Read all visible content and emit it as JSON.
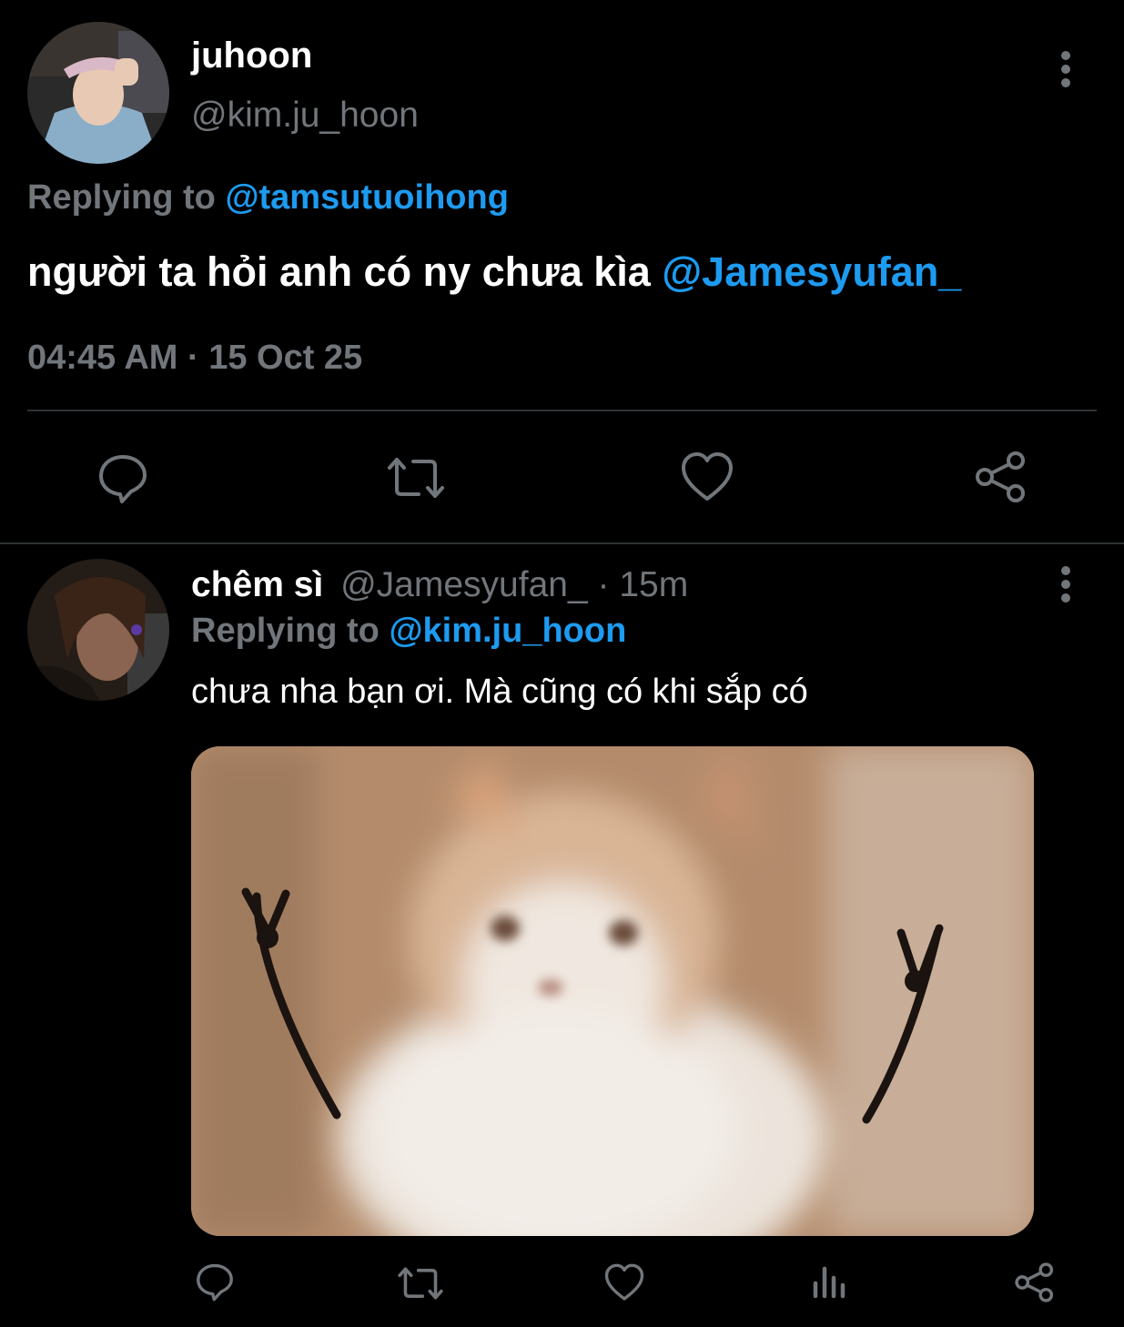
{
  "tweet": {
    "author_name": "juhoon",
    "author_handle": "@kim.ju_hoon",
    "replying_prefix": "Replying to",
    "replying_to": "@tamsutuoihong",
    "text": "người ta hỏi anh có ny chưa kìa",
    "mention": "@Jamesyufan_",
    "timestamp": "04:45 AM · 15 Oct 25",
    "actions": [
      "reply-icon",
      "retweet-icon",
      "like-icon",
      "share-icon"
    ],
    "more_icon": "more-vertical-icon"
  },
  "reply": {
    "author_name": "chêm sì",
    "author_handle": "@Jamesyufan_",
    "separator": "·",
    "time_ago": "15m",
    "replying_prefix": "Replying to",
    "replying_to": "@kim.ju_hoon",
    "text": "chưa nha bạn ơi. Mà cũng có khi sắp có",
    "media_alt": "blurry cat meme image",
    "actions": [
      "reply-icon",
      "retweet-icon",
      "like-icon",
      "analytics-icon",
      "share-icon"
    ],
    "more_icon": "more-vertical-icon"
  },
  "colors": {
    "background": "#000000",
    "text": "#ffffff",
    "muted": "#71767b",
    "link": "#1d9bf0",
    "divider": "#2f3336"
  }
}
